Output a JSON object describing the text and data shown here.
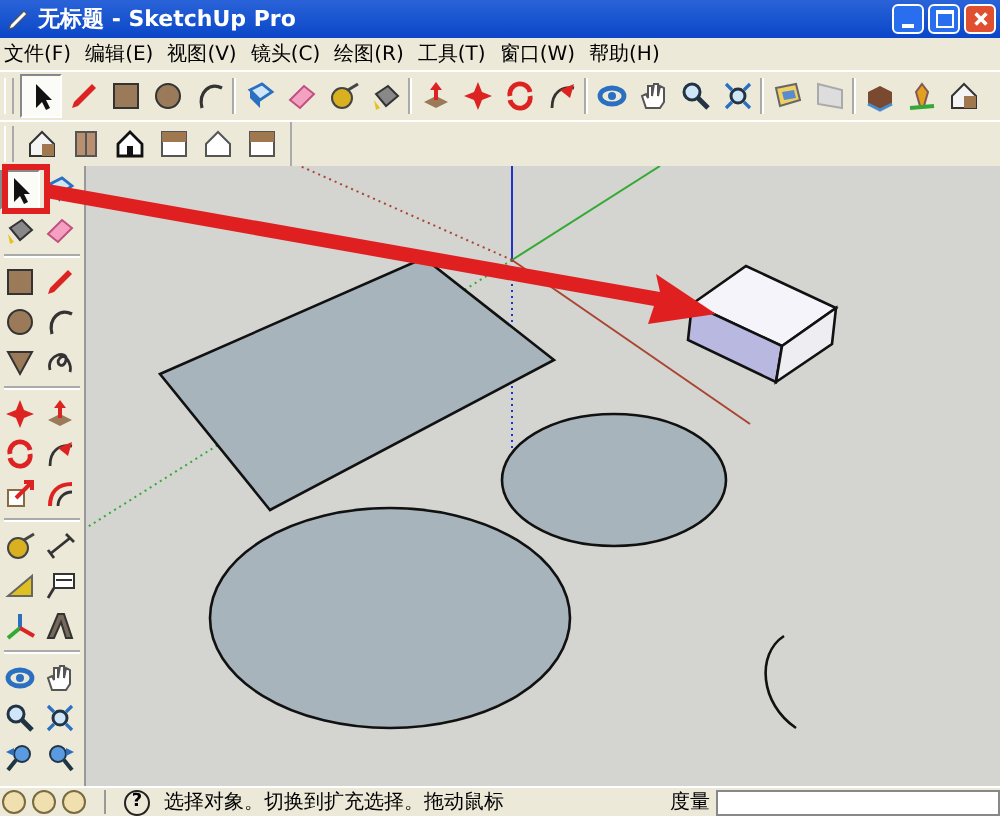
{
  "window": {
    "title": "无标题 - SketchUp Pro"
  },
  "menu": [
    "文件(F)",
    "编辑(E)",
    "视图(V)",
    "镜头(C)",
    "绘图(R)",
    "工具(T)",
    "窗口(W)",
    "帮助(H)"
  ],
  "top_toolbar": [
    [
      {
        "kind": "select",
        "selected": true
      },
      {
        "kind": "pencil",
        "selected": false
      },
      {
        "kind": "rectangle",
        "selected": false
      },
      {
        "kind": "circle",
        "selected": false
      },
      {
        "kind": "arc",
        "selected": false
      }
    ],
    [
      {
        "kind": "component",
        "selected": false
      },
      {
        "kind": "eraser",
        "selected": false
      },
      {
        "kind": "tape",
        "selected": false
      },
      {
        "kind": "paint",
        "selected": false
      }
    ],
    [
      {
        "kind": "pushpull",
        "selected": false
      },
      {
        "kind": "move",
        "selected": false
      },
      {
        "kind": "rotate",
        "selected": false
      },
      {
        "kind": "followme",
        "selected": false
      }
    ],
    [
      {
        "kind": "orbit",
        "selected": false
      },
      {
        "kind": "pan",
        "selected": false
      },
      {
        "kind": "zoom",
        "selected": false
      },
      {
        "kind": "zoomext",
        "selected": false
      }
    ],
    [
      {
        "kind": "section",
        "selected": false
      },
      {
        "kind": "fog",
        "selected": false
      }
    ],
    [
      {
        "kind": "warehouse",
        "selected": false
      },
      {
        "kind": "geo",
        "selected": false
      },
      {
        "kind": "iso",
        "selected": false
      }
    ]
  ],
  "view_toolbar": [
    {
      "kind": "iso",
      "selected": false
    },
    {
      "kind": "door",
      "selected": false
    },
    {
      "kind": "front",
      "selected": false
    },
    {
      "kind": "top",
      "selected": false
    },
    {
      "kind": "right",
      "selected": false
    },
    {
      "kind": "top",
      "selected": false
    }
  ],
  "left_toolbar": [
    [
      {
        "kind": "select",
        "selected": true
      },
      {
        "kind": "component",
        "selected": false
      },
      {
        "kind": "paint",
        "selected": false
      },
      {
        "kind": "eraser",
        "selected": false
      }
    ],
    [
      {
        "kind": "rectangle",
        "selected": false
      },
      {
        "kind": "pencil",
        "selected": false
      },
      {
        "kind": "circle",
        "selected": false
      },
      {
        "kind": "arc",
        "selected": false
      },
      {
        "kind": "polygon",
        "selected": false
      },
      {
        "kind": "freehand",
        "selected": false
      }
    ],
    [
      {
        "kind": "move",
        "selected": false
      },
      {
        "kind": "pushpull",
        "selected": false
      },
      {
        "kind": "rotate",
        "selected": false
      },
      {
        "kind": "followme",
        "selected": false
      },
      {
        "kind": "scale",
        "selected": false
      },
      {
        "kind": "offset",
        "selected": false
      }
    ],
    [
      {
        "kind": "tape",
        "selected": false
      },
      {
        "kind": "dimension",
        "selected": false
      },
      {
        "kind": "protractor",
        "selected": false
      },
      {
        "kind": "label",
        "selected": false
      },
      {
        "kind": "axes",
        "selected": false
      },
      {
        "kind": "text3d",
        "selected": false
      }
    ],
    [
      {
        "kind": "orbit",
        "selected": false
      },
      {
        "kind": "pan",
        "selected": false
      },
      {
        "kind": "zoom",
        "selected": false
      },
      {
        "kind": "zoomext",
        "selected": false
      },
      {
        "kind": "previous",
        "selected": false
      },
      {
        "kind": "next",
        "selected": false
      }
    ]
  ],
  "status_bar": {
    "help_glyph": "?",
    "message": "选择对象。切换到扩充选择。拖动鼠标",
    "measurements_label": "度量"
  }
}
